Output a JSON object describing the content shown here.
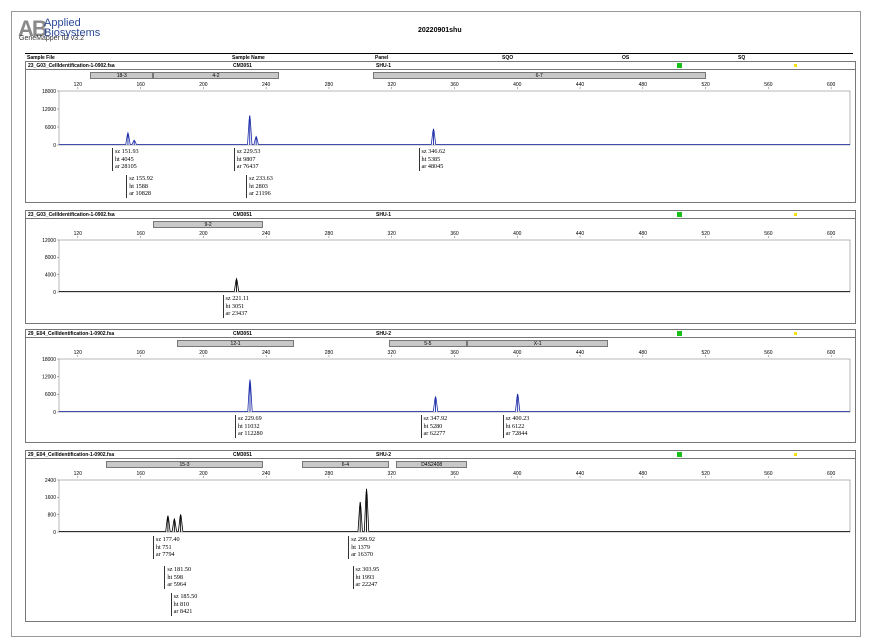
{
  "header": {
    "logo_text": "Applied Biosystems",
    "logo_line1": "Applied",
    "logo_line2": "Biosystems",
    "version": "GeneMapper ID v3.2",
    "title": "20220901shu",
    "columns": [
      "Sample File",
      "Sample Name",
      "Panel",
      "SQO",
      "OS",
      "SQ"
    ]
  },
  "colors": {
    "blue": "#1a2aa8",
    "black": "#000000",
    "green": "#18c018",
    "yellow": "#f2e210"
  },
  "chart_data": [
    {
      "type": "line",
      "sample_file": "23_G03_CellIdentification-1-0902.fsa",
      "sample_name": "CM3051",
      "panel": "SHU-1",
      "color": "#1a2aa8",
      "bins": [
        {
          "label": "18-3",
          "start": 128,
          "end": 168
        },
        {
          "label": "4-2",
          "start": 168,
          "end": 248
        },
        {
          "label": "6-7",
          "start": 308,
          "end": 520
        }
      ],
      "xlim": [
        108,
        612
      ],
      "x_ticks": [
        120,
        160,
        200,
        240,
        280,
        320,
        360,
        400,
        440,
        480,
        520,
        560,
        600
      ],
      "ylim": [
        0,
        18000
      ],
      "y_ticks": [
        0,
        6000,
        12000,
        18000
      ],
      "peaks": [
        {
          "x": 151.93,
          "y": 4045
        },
        {
          "x": 155.92,
          "y": 1588
        },
        {
          "x": 229.53,
          "y": 9807
        },
        {
          "x": 233.63,
          "y": 2803
        },
        {
          "x": 346.62,
          "y": 5385
        }
      ],
      "labels": [
        {
          "lines": [
            "sz 151.93",
            "ht 4045",
            "ar 28105"
          ]
        },
        {
          "lines": [
            "sz 155.92",
            "ht 1588",
            "ar 10828"
          ]
        },
        {
          "lines": [
            "sz 229.53",
            "ht 9807",
            "ar 76437"
          ]
        },
        {
          "lines": [
            "sz 233.63",
            "ht 2803",
            "ar 21196"
          ]
        },
        {
          "lines": [
            "sz 346.62",
            "ht 5385",
            "ar 48045"
          ]
        }
      ]
    },
    {
      "type": "line",
      "sample_file": "23_G03_CellIdentification-1-0902.fsa",
      "sample_name": "CM3051",
      "panel": "SHU-1",
      "color": "#000000",
      "bins": [
        {
          "label": "9-2",
          "start": 168,
          "end": 238
        }
      ],
      "xlim": [
        108,
        612
      ],
      "x_ticks": [
        120,
        160,
        200,
        240,
        280,
        320,
        360,
        400,
        440,
        480,
        520,
        560,
        600
      ],
      "ylim": [
        0,
        12000
      ],
      "y_ticks": [
        0,
        4000,
        8000,
        12000
      ],
      "peaks": [
        {
          "x": 221.11,
          "y": 3051
        }
      ],
      "labels": [
        {
          "lines": [
            "sz 221.11",
            "ht 3051",
            "ar 23437"
          ]
        }
      ]
    },
    {
      "type": "line",
      "sample_file": "29_E04_CellIdentification-1-0902.fsa",
      "sample_name": "CM3051",
      "panel": "SHU-2",
      "color": "#1a2aa8",
      "bins": [
        {
          "label": "12-1",
          "start": 183,
          "end": 258
        },
        {
          "label": "5-5",
          "start": 318,
          "end": 368
        },
        {
          "label": "X-1",
          "start": 368,
          "end": 458
        }
      ],
      "xlim": [
        108,
        612
      ],
      "x_ticks": [
        120,
        160,
        200,
        240,
        280,
        320,
        360,
        400,
        440,
        480,
        520,
        560,
        600
      ],
      "ylim": [
        0,
        18000
      ],
      "y_ticks": [
        0,
        6000,
        12000,
        18000
      ],
      "peaks": [
        {
          "x": 229.69,
          "y": 11032
        },
        {
          "x": 347.92,
          "y": 5280
        },
        {
          "x": 400.23,
          "y": 6122
        }
      ],
      "labels": [
        {
          "lines": [
            "sz 229.69",
            "ht 11032",
            "ar 112280"
          ]
        },
        {
          "lines": [
            "sz 347.92",
            "ht 5280",
            "ar 62277"
          ]
        },
        {
          "lines": [
            "sz 400.23",
            "ht 6122",
            "ar 72844"
          ]
        }
      ]
    },
    {
      "type": "line",
      "sample_file": "29_E04_CellIdentification-1-0902.fsa",
      "sample_name": "CM3051",
      "panel": "SHU-2",
      "color": "#000000",
      "bins": [
        {
          "label": "15-3",
          "start": 138,
          "end": 238
        },
        {
          "label": "6-4",
          "start": 263,
          "end": 318
        },
        {
          "label": "D4S2408",
          "start": 323,
          "end": 368
        }
      ],
      "xlim": [
        108,
        612
      ],
      "x_ticks": [
        120,
        160,
        200,
        240,
        280,
        320,
        360,
        400,
        440,
        480,
        520,
        560,
        600
      ],
      "ylim": [
        0,
        2400
      ],
      "y_ticks": [
        0,
        800,
        1600,
        2400
      ],
      "peaks": [
        {
          "x": 177.4,
          "y": 751
        },
        {
          "x": 181.5,
          "y": 598
        },
        {
          "x": 185.5,
          "y": 810
        },
        {
          "x": 299.92,
          "y": 1379
        },
        {
          "x": 303.95,
          "y": 1993
        }
      ],
      "labels": [
        {
          "lines": [
            "sz 177.40",
            "ht 751",
            "ar 7794"
          ]
        },
        {
          "lines": [
            "sz 181.50",
            "ht 598",
            "ar 5964"
          ]
        },
        {
          "lines": [
            "sz 185.50",
            "ht 810",
            "ar 8421"
          ]
        },
        {
          "lines": [
            "sz 299.92",
            "ht 1379",
            "ar 16370"
          ]
        },
        {
          "lines": [
            "sz 303.95",
            "ht 1993",
            "ar 22247"
          ]
        }
      ]
    }
  ]
}
